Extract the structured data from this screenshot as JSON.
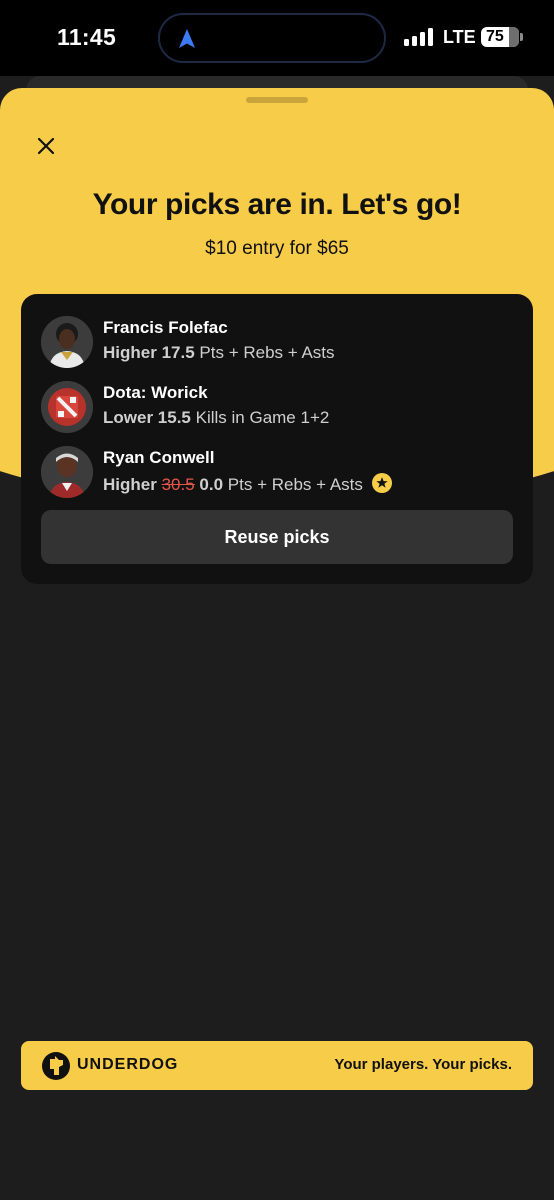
{
  "status_bar": {
    "time": "11:45",
    "carrier": "LTE",
    "battery": "75"
  },
  "header": {
    "title": "Your picks are in. Let's go!",
    "subtitle": "$10 entry for $65"
  },
  "picks": [
    {
      "name": "Francis Folefac",
      "direction": "Higher",
      "line_old": "",
      "line": "17.5",
      "stat": "Pts + Rebs + Asts",
      "avatar_icon": "player-photo",
      "badge_icon": ""
    },
    {
      "name": "Dota: Worick",
      "direction": "Lower",
      "line_old": "",
      "line": "15.5",
      "stat": "Kills in Game 1+2",
      "avatar_icon": "dota-logo",
      "badge_icon": ""
    },
    {
      "name": "Ryan Conwell",
      "direction": "Higher",
      "line_old": "30.5",
      "line": "0.0",
      "stat": "Pts + Rebs + Asts",
      "avatar_icon": "player-photo",
      "badge_icon": "star-badge"
    }
  ],
  "reuse_button": "Reuse picks",
  "banner": {
    "brand": "UNDERDOG",
    "tagline": "Your players. Your picks."
  },
  "colors": {
    "accent": "#f6cc48",
    "background": "#1d1d1d",
    "card": "#111111",
    "strike": "#e4564a"
  }
}
